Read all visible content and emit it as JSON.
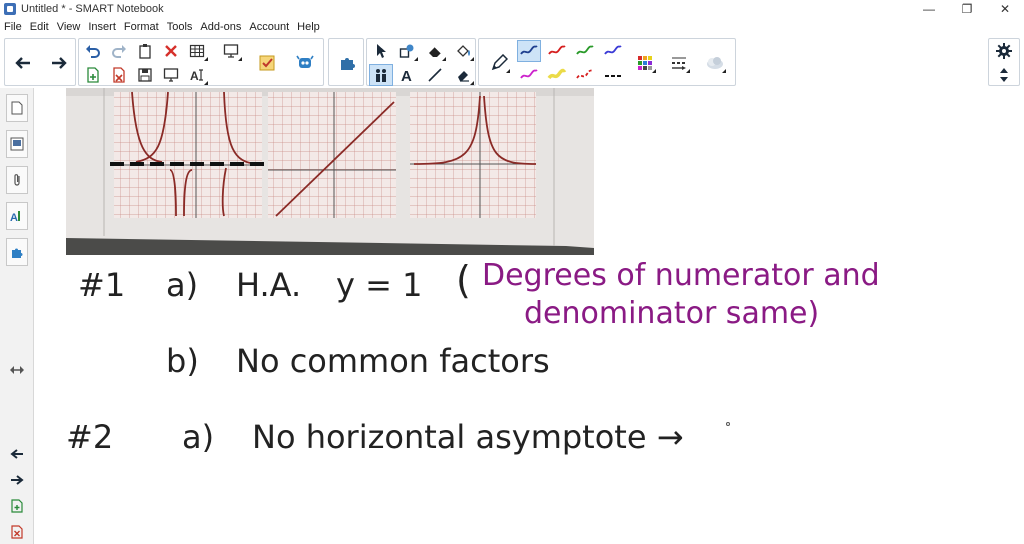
{
  "window": {
    "title": "Untitled * - SMART Notebook",
    "minimize": "—",
    "maximize": "❐",
    "close": "✕"
  },
  "menu": [
    "File",
    "Edit",
    "View",
    "Insert",
    "Format",
    "Tools",
    "Add-ons",
    "Account",
    "Help"
  ],
  "toolbar": {
    "pen_colors": [
      "#1f3f8f",
      "#d61f1f",
      "#2a9a2a",
      "#3b3bd6",
      "#cc22cc",
      "#e6d21a",
      "#d61f1f",
      "#111111"
    ],
    "selected_pen_index": 0
  },
  "notes": {
    "line1_num": "#1",
    "line1_a": "a)",
    "line1_ha": "H.A.",
    "line1_eq": "y = 1",
    "line1_paren": "(",
    "line1_note_1": "Degrees of numerator and",
    "line1_note_2": "denominator same)",
    "line1_b": "b)",
    "line1_b_text": "No common factors",
    "line2_num": "#2",
    "line2_a": "a)",
    "line2_text": "No horizontal asymptote →",
    "note_color": "#8a1a84",
    "ink_color": "#111111"
  },
  "colors": {
    "graph_grid": "#c98b86",
    "graph_curve": "#8a2a26",
    "photo_bg": "#4b4b49",
    "paper": "#e7e4e2"
  }
}
